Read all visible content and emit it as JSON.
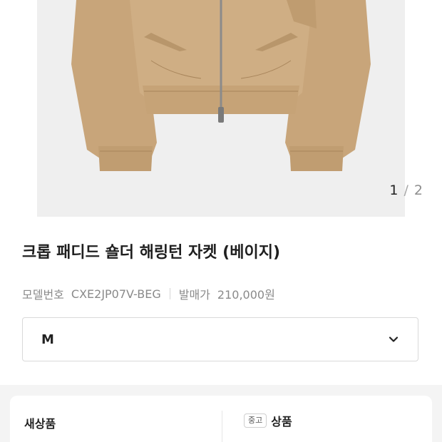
{
  "gallery": {
    "current": "1",
    "separator": "/",
    "total": "2"
  },
  "product": {
    "title": "크롭 패디드 숄더 해링턴 자켓 (베이지)",
    "model_label": "모델번호",
    "model_number": "CXE2JP07V-BEG",
    "release_price_label": "발매가",
    "release_price": "210,000원"
  },
  "size_select": {
    "value": "M",
    "icon": "chevron-down-icon"
  },
  "condition_tabs": {
    "new_label": "새상품",
    "used_badge": "중고",
    "used_label": "상품"
  },
  "colors": {
    "jacket": "#c9a77c",
    "jacket_shadow": "#a8855b",
    "photo_bg": "#efefef",
    "band_bg": "#f4f4f4"
  }
}
